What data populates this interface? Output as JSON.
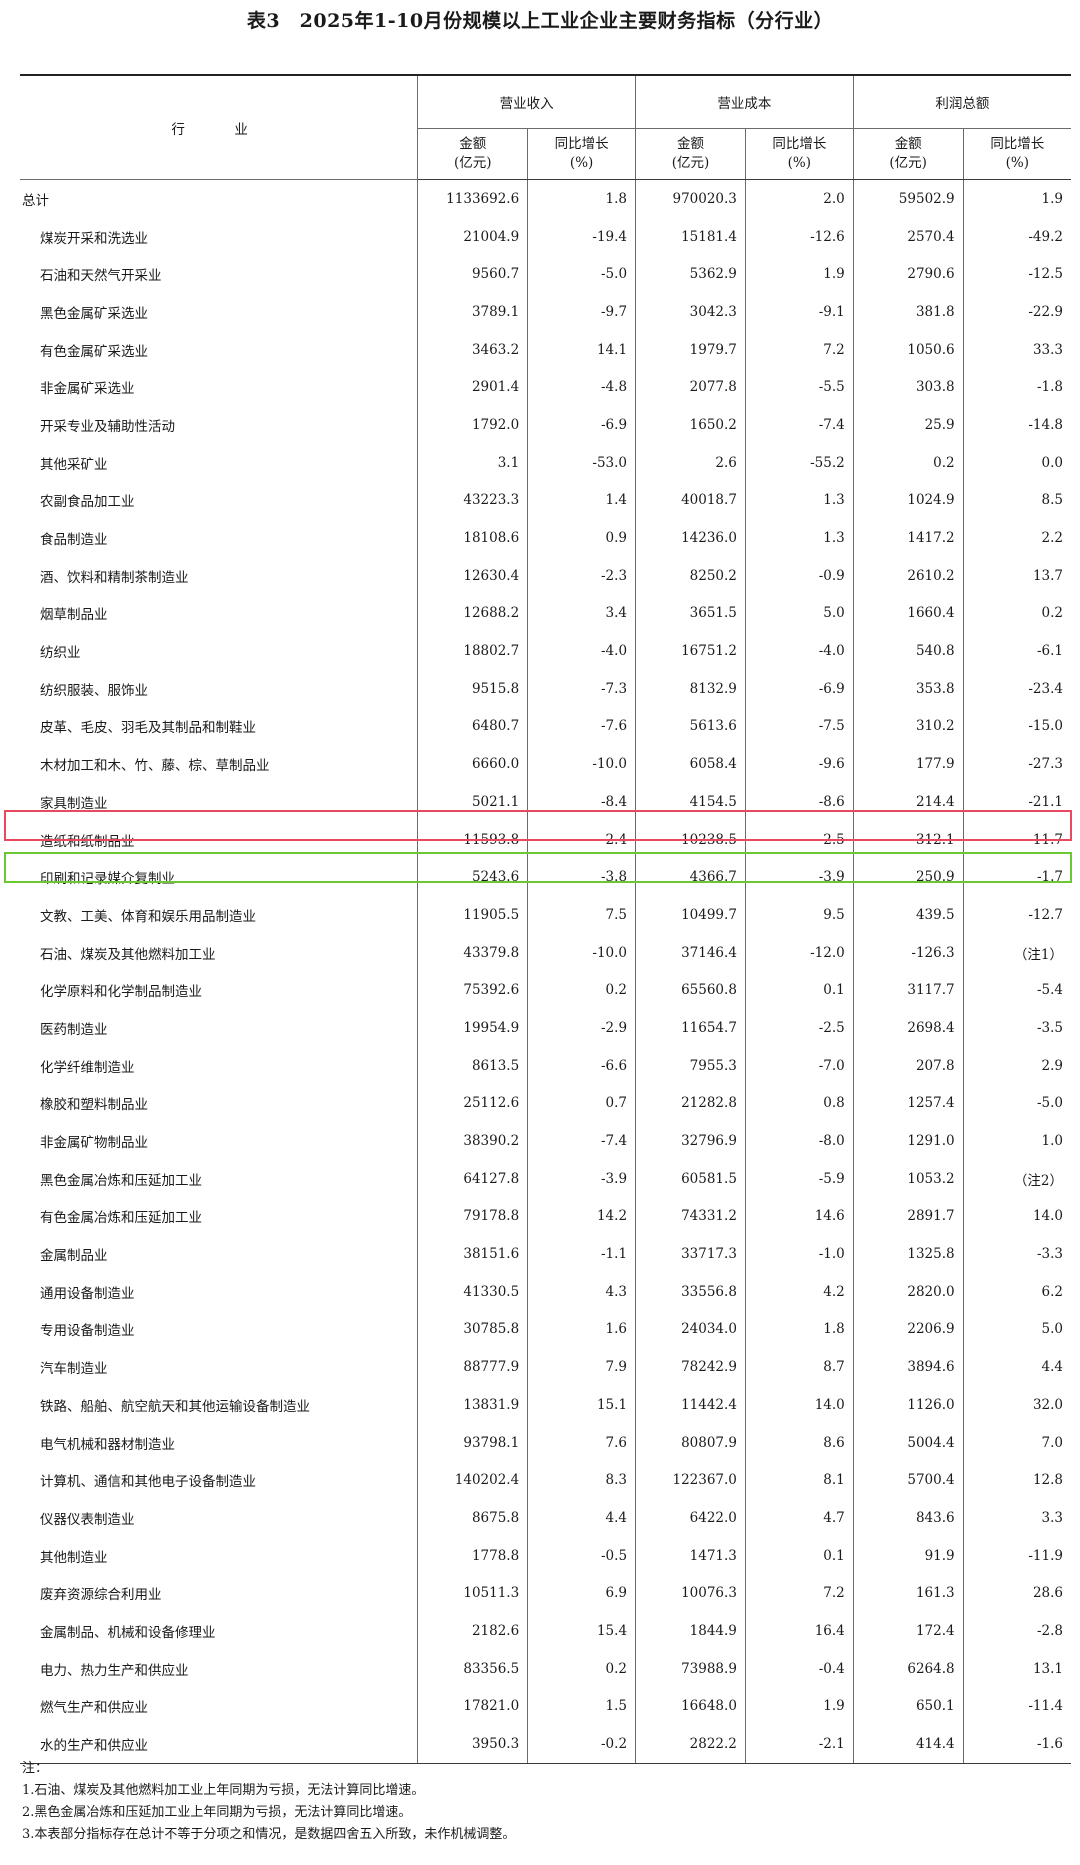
{
  "title": "表3　2025年1-10月份规模以上工业企业主要财务指标（分行业）",
  "headers": {
    "industry": "行　业",
    "revenue": "营业收入",
    "cost": "营业成本",
    "profit": "利润总额",
    "amount_line1": "金额",
    "amount_line2": "(亿元)",
    "growth_line1": "同比增长",
    "growth_line2": "(%)"
  },
  "rows": [
    {
      "name": "总计",
      "rev": "1133692.6",
      "rev_g": "1.8",
      "cost": "970020.3",
      "cost_g": "2.0",
      "profit": "59502.9",
      "profit_g": "1.9"
    },
    {
      "name": "煤炭开采和洗选业",
      "rev": "21004.9",
      "rev_g": "-19.4",
      "cost": "15181.4",
      "cost_g": "-12.6",
      "profit": "2570.4",
      "profit_g": "-49.2"
    },
    {
      "name": "石油和天然气开采业",
      "rev": "9560.7",
      "rev_g": "-5.0",
      "cost": "5362.9",
      "cost_g": "1.9",
      "profit": "2790.6",
      "profit_g": "-12.5"
    },
    {
      "name": "黑色金属矿采选业",
      "rev": "3789.1",
      "rev_g": "-9.7",
      "cost": "3042.3",
      "cost_g": "-9.1",
      "profit": "381.8",
      "profit_g": "-22.9"
    },
    {
      "name": "有色金属矿采选业",
      "rev": "3463.2",
      "rev_g": "14.1",
      "cost": "1979.7",
      "cost_g": "7.2",
      "profit": "1050.6",
      "profit_g": "33.3"
    },
    {
      "name": "非金属矿采选业",
      "rev": "2901.4",
      "rev_g": "-4.8",
      "cost": "2077.8",
      "cost_g": "-5.5",
      "profit": "303.8",
      "profit_g": "-1.8"
    },
    {
      "name": "开采专业及辅助性活动",
      "rev": "1792.0",
      "rev_g": "-6.9",
      "cost": "1650.2",
      "cost_g": "-7.4",
      "profit": "25.9",
      "profit_g": "-14.8"
    },
    {
      "name": "其他采矿业",
      "rev": "3.1",
      "rev_g": "-53.0",
      "cost": "2.6",
      "cost_g": "-55.2",
      "profit": "0.2",
      "profit_g": "0.0"
    },
    {
      "name": "农副食品加工业",
      "rev": "43223.3",
      "rev_g": "1.4",
      "cost": "40018.7",
      "cost_g": "1.3",
      "profit": "1024.9",
      "profit_g": "8.5"
    },
    {
      "name": "食品制造业",
      "rev": "18108.6",
      "rev_g": "0.9",
      "cost": "14236.0",
      "cost_g": "1.3",
      "profit": "1417.2",
      "profit_g": "2.2"
    },
    {
      "name": "酒、饮料和精制茶制造业",
      "rev": "12630.4",
      "rev_g": "-2.3",
      "cost": "8250.2",
      "cost_g": "-0.9",
      "profit": "2610.2",
      "profit_g": "13.7"
    },
    {
      "name": "烟草制品业",
      "rev": "12688.2",
      "rev_g": "3.4",
      "cost": "3651.5",
      "cost_g": "5.0",
      "profit": "1660.4",
      "profit_g": "0.2"
    },
    {
      "name": "纺织业",
      "rev": "18802.7",
      "rev_g": "-4.0",
      "cost": "16751.2",
      "cost_g": "-4.0",
      "profit": "540.8",
      "profit_g": "-6.1"
    },
    {
      "name": "纺织服装、服饰业",
      "rev": "9515.8",
      "rev_g": "-7.3",
      "cost": "8132.9",
      "cost_g": "-6.9",
      "profit": "353.8",
      "profit_g": "-23.4"
    },
    {
      "name": "皮革、毛皮、羽毛及其制品和制鞋业",
      "rev": "6480.7",
      "rev_g": "-7.6",
      "cost": "5613.6",
      "cost_g": "-7.5",
      "profit": "310.2",
      "profit_g": "-15.0"
    },
    {
      "name": "木材加工和木、竹、藤、棕、草制品业",
      "rev": "6660.0",
      "rev_g": "-10.0",
      "cost": "6058.4",
      "cost_g": "-9.6",
      "profit": "177.9",
      "profit_g": "-27.3"
    },
    {
      "name": "家具制造业",
      "rev": "5021.1",
      "rev_g": "-8.4",
      "cost": "4154.5",
      "cost_g": "-8.6",
      "profit": "214.4",
      "profit_g": "-21.1"
    },
    {
      "name": "造纸和纸制品业",
      "rev": "11593.8",
      "rev_g": "-2.4",
      "cost": "10238.5",
      "cost_g": "-2.5",
      "profit": "312.1",
      "profit_g": "-11.7"
    },
    {
      "name": "印刷和记录媒介复制业",
      "rev": "5243.6",
      "rev_g": "-3.8",
      "cost": "4366.7",
      "cost_g": "-3.9",
      "profit": "250.9",
      "profit_g": "-1.7"
    },
    {
      "name": "文教、工美、体育和娱乐用品制造业",
      "rev": "11905.5",
      "rev_g": "7.5",
      "cost": "10499.7",
      "cost_g": "9.5",
      "profit": "439.5",
      "profit_g": "-12.7"
    },
    {
      "name": "石油、煤炭及其他燃料加工业",
      "rev": "43379.8",
      "rev_g": "-10.0",
      "cost": "37146.4",
      "cost_g": "-12.0",
      "profit": "-126.3",
      "profit_g": "（注1）"
    },
    {
      "name": "化学原料和化学制品制造业",
      "rev": "75392.6",
      "rev_g": "0.2",
      "cost": "65560.8",
      "cost_g": "0.1",
      "profit": "3117.7",
      "profit_g": "-5.4"
    },
    {
      "name": "医药制造业",
      "rev": "19954.9",
      "rev_g": "-2.9",
      "cost": "11654.7",
      "cost_g": "-2.5",
      "profit": "2698.4",
      "profit_g": "-3.5"
    },
    {
      "name": "化学纤维制造业",
      "rev": "8613.5",
      "rev_g": "-6.6",
      "cost": "7955.3",
      "cost_g": "-7.0",
      "profit": "207.8",
      "profit_g": "2.9"
    },
    {
      "name": "橡胶和塑料制品业",
      "rev": "25112.6",
      "rev_g": "0.7",
      "cost": "21282.8",
      "cost_g": "0.8",
      "profit": "1257.4",
      "profit_g": "-5.0"
    },
    {
      "name": "非金属矿物制品业",
      "rev": "38390.2",
      "rev_g": "-7.4",
      "cost": "32796.9",
      "cost_g": "-8.0",
      "profit": "1291.0",
      "profit_g": "1.0"
    },
    {
      "name": "黑色金属冶炼和压延加工业",
      "rev": "64127.8",
      "rev_g": "-3.9",
      "cost": "60581.5",
      "cost_g": "-5.9",
      "profit": "1053.2",
      "profit_g": "（注2）"
    },
    {
      "name": "有色金属冶炼和压延加工业",
      "rev": "79178.8",
      "rev_g": "14.2",
      "cost": "74331.2",
      "cost_g": "14.6",
      "profit": "2891.7",
      "profit_g": "14.0"
    },
    {
      "name": "金属制品业",
      "rev": "38151.6",
      "rev_g": "-1.1",
      "cost": "33717.3",
      "cost_g": "-1.0",
      "profit": "1325.8",
      "profit_g": "-3.3"
    },
    {
      "name": "通用设备制造业",
      "rev": "41330.5",
      "rev_g": "4.3",
      "cost": "33556.8",
      "cost_g": "4.2",
      "profit": "2820.0",
      "profit_g": "6.2"
    },
    {
      "name": "专用设备制造业",
      "rev": "30785.8",
      "rev_g": "1.6",
      "cost": "24034.0",
      "cost_g": "1.8",
      "profit": "2206.9",
      "profit_g": "5.0"
    },
    {
      "name": "汽车制造业",
      "rev": "88777.9",
      "rev_g": "7.9",
      "cost": "78242.9",
      "cost_g": "8.7",
      "profit": "3894.6",
      "profit_g": "4.4"
    },
    {
      "name": "铁路、船舶、航空航天和其他运输设备制造业",
      "rev": "13831.9",
      "rev_g": "15.1",
      "cost": "11442.4",
      "cost_g": "14.0",
      "profit": "1126.0",
      "profit_g": "32.0"
    },
    {
      "name": "电气机械和器材制造业",
      "rev": "93798.1",
      "rev_g": "7.6",
      "cost": "80807.9",
      "cost_g": "8.6",
      "profit": "5004.4",
      "profit_g": "7.0"
    },
    {
      "name": "计算机、通信和其他电子设备制造业",
      "rev": "140202.4",
      "rev_g": "8.3",
      "cost": "122367.0",
      "cost_g": "8.1",
      "profit": "5700.4",
      "profit_g": "12.8"
    },
    {
      "name": "仪器仪表制造业",
      "rev": "8675.8",
      "rev_g": "4.4",
      "cost": "6422.0",
      "cost_g": "4.7",
      "profit": "843.6",
      "profit_g": "3.3"
    },
    {
      "name": "其他制造业",
      "rev": "1778.8",
      "rev_g": "-0.5",
      "cost": "1471.3",
      "cost_g": "0.1",
      "profit": "91.9",
      "profit_g": "-11.9"
    },
    {
      "name": "废弃资源综合利用业",
      "rev": "10511.3",
      "rev_g": "6.9",
      "cost": "10076.3",
      "cost_g": "7.2",
      "profit": "161.3",
      "profit_g": "28.6"
    },
    {
      "name": "金属制品、机械和设备修理业",
      "rev": "2182.6",
      "rev_g": "15.4",
      "cost": "1844.9",
      "cost_g": "16.4",
      "profit": "172.4",
      "profit_g": "-2.8"
    },
    {
      "name": "电力、热力生产和供应业",
      "rev": "83356.5",
      "rev_g": "0.2",
      "cost": "73988.9",
      "cost_g": "-0.4",
      "profit": "6264.8",
      "profit_g": "13.1"
    },
    {
      "name": "燃气生产和供应业",
      "rev": "17821.0",
      "rev_g": "1.5",
      "cost": "16648.0",
      "cost_g": "1.9",
      "profit": "650.1",
      "profit_g": "-11.4"
    },
    {
      "name": "水的生产和供应业",
      "rev": "3950.3",
      "rev_g": "-0.2",
      "cost": "2822.2",
      "cost_g": "-2.1",
      "profit": "414.4",
      "profit_g": "-1.6"
    }
  ],
  "notes": [
    "注：",
    "1.石油、煤炭及其他燃料加工业上年同期为亏损，无法计算同比增速。",
    "2.黑色金属冶炼和压延加工业上年同期为亏损，无法计算同比增速。",
    "3.本表部分指标存在总计不等于分项之和情况，是数据四舍五入所致，未作机械调整。"
  ],
  "colors": {
    "highlight_red": "#e8495f",
    "highlight_green": "#6cc832"
  }
}
